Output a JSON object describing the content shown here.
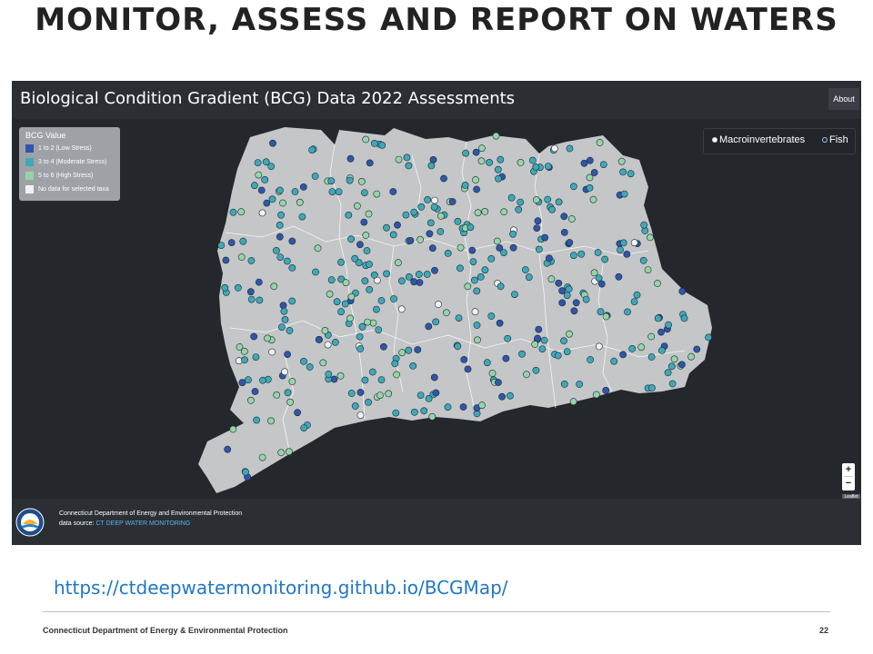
{
  "slide": {
    "title": "MONITOR, ASSESS AND REPORT ON WATERS",
    "url": "https://ctdeepwatermonitoring.github.io/BCGMap/",
    "footer_text": "Connecticut  Department of Energy & Environmental Protection",
    "page_number": "22"
  },
  "app": {
    "title": "Biological Condition Gradient (BCG) Data 2022 Assessments",
    "about_label": "About",
    "legend": {
      "title": "BCG Value",
      "items": [
        {
          "label": "1 to 2 (Low Stress)",
          "color": "#2f56a8"
        },
        {
          "label": "3 to 4 (Moderate Stress)",
          "color": "#3fa8b8"
        },
        {
          "label": "5 to 6 (High Stress)",
          "color": "#96d4a8"
        },
        {
          "label": "No data for selected taxa",
          "color": "#f2f2f2"
        }
      ]
    },
    "taxa_toggle": {
      "options": [
        "Macroinvertebrates",
        "Fish"
      ],
      "selected": "Macroinvertebrates"
    },
    "zoom": {
      "in_label": "+",
      "out_label": "−"
    },
    "attribution": "Leaflet",
    "footer": {
      "org": "Connecticut Department of Energy and Environmental Protection",
      "source_prefix": "data source: ",
      "source_link": "CT DEEP WATER MONITORING"
    },
    "colors": {
      "land": "#c5c6c8",
      "background": "#24272b",
      "basin_line": "#ffffff"
    }
  }
}
